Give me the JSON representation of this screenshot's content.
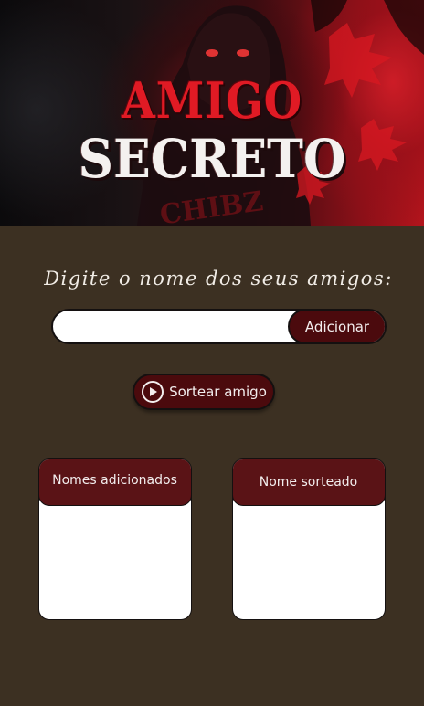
{
  "banner": {
    "title_line1": "AMIGO",
    "title_line2": "SECRETO"
  },
  "form": {
    "prompt": "Digite o nome dos seus amigos:",
    "input_value": "",
    "input_placeholder": "",
    "add_label": "Adicionar"
  },
  "draw": {
    "label": "Sortear amigo",
    "icon": "play-circle-icon"
  },
  "panels": {
    "added": {
      "title": "Nomes adicionados",
      "items": []
    },
    "drawn": {
      "title": "Nome sorteado",
      "items": []
    }
  },
  "colors": {
    "background": "#3c3022",
    "button": "#4b0a0d",
    "panel_header": "#5a1316",
    "title_red": "#e01a24",
    "title_white": "#f4f1ef"
  }
}
